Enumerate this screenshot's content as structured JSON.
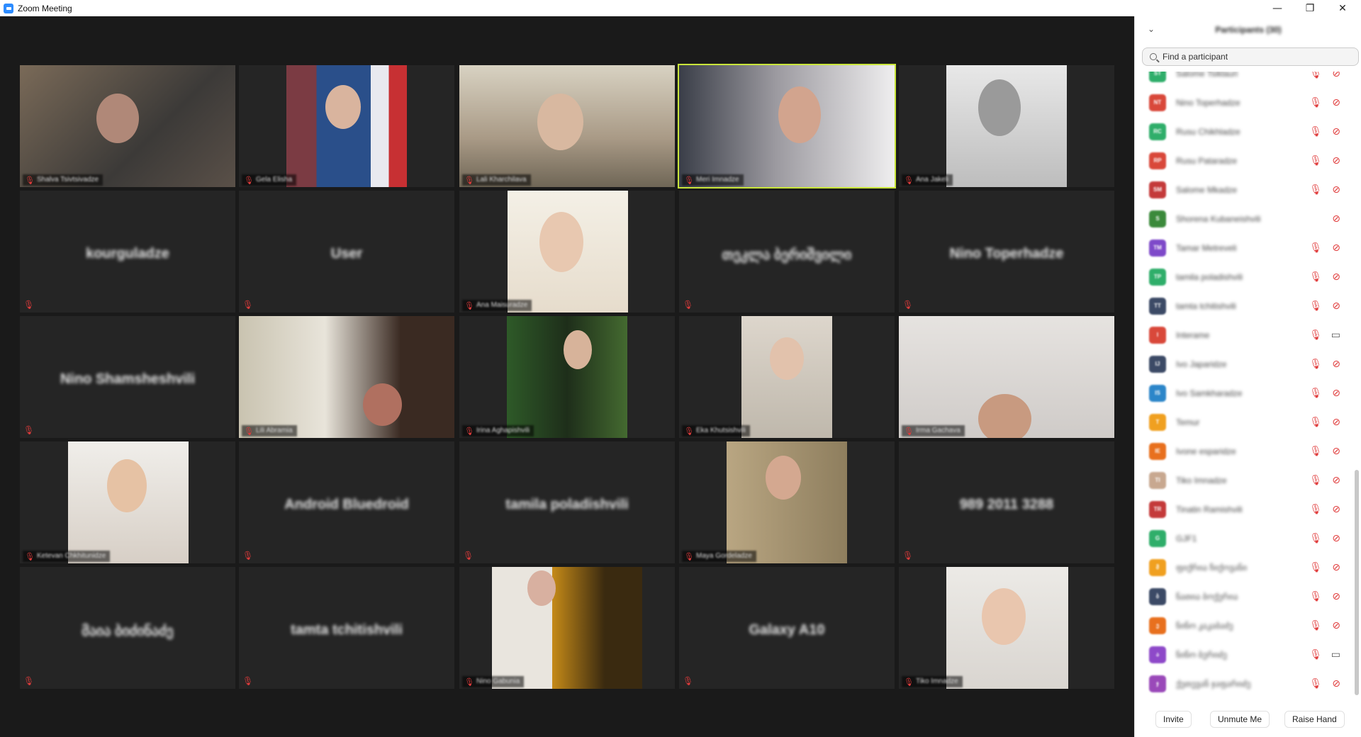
{
  "window": {
    "title": "Zoom Meeting",
    "minimize": "—",
    "maximize": "❐",
    "close": "✕"
  },
  "colors": {
    "active_speaker_border": "#c9e53a",
    "muted_icon": "#e03b3b",
    "tile_bg": "#252525"
  },
  "gallery": {
    "tiles": [
      {
        "kind": "video",
        "label": "Shalva Tsivtsivadze"
      },
      {
        "kind": "video",
        "label": "Gela Elisha"
      },
      {
        "kind": "video",
        "label": "Lali Kharchilava"
      },
      {
        "kind": "video",
        "label": "Meri Imnadze",
        "active": true
      },
      {
        "kind": "video",
        "label": "Ana Jakeli"
      },
      {
        "kind": "name",
        "name": "kourguladze"
      },
      {
        "kind": "name",
        "name": "User"
      },
      {
        "kind": "video",
        "label": "Ana Maisuradze"
      },
      {
        "kind": "name",
        "name": "თეკლა ბერიშვილი"
      },
      {
        "kind": "name",
        "name": "Nino Toperhadze"
      },
      {
        "kind": "name",
        "name": "Nino Shamsheshvili"
      },
      {
        "kind": "video",
        "label": "Lili Abramia"
      },
      {
        "kind": "video",
        "label": "Irina Aghapishvili"
      },
      {
        "kind": "video",
        "label": "Eka Khutsishvili"
      },
      {
        "kind": "video",
        "label": "Irma Gachava"
      },
      {
        "kind": "video",
        "label": "Ketevan Chkhitunidze"
      },
      {
        "kind": "name",
        "name": "Android Bluedroid"
      },
      {
        "kind": "name",
        "name": "tamila poladishvili"
      },
      {
        "kind": "video",
        "label": "Maya Gordeladze"
      },
      {
        "kind": "name",
        "name": "989 2011 3288"
      },
      {
        "kind": "name",
        "name": "მაია ბიძინაძე"
      },
      {
        "kind": "name",
        "name": "tamta tchitishvili"
      },
      {
        "kind": "video",
        "label": "Nino Gabunia"
      },
      {
        "kind": "name",
        "name": "Galaxy A10"
      },
      {
        "kind": "video",
        "label": "Tiko Imnadze"
      }
    ]
  },
  "panel": {
    "title": "Participants (30)",
    "collapse_icon": "⌄",
    "search_placeholder": "Find a participant",
    "participants": [
      {
        "initials": "ST",
        "name": "Salome Tsiklauri",
        "color": "#2fae6a",
        "mic": "muted",
        "cam": "off"
      },
      {
        "initials": "NT",
        "name": "Nino Toperhadze",
        "color": "#d9483a",
        "mic": "muted",
        "cam": "off"
      },
      {
        "initials": "RC",
        "name": "Rusu Chikhladze",
        "color": "#2fae6a",
        "mic": "muted",
        "cam": "off"
      },
      {
        "initials": "RP",
        "name": "Rusu Pataradze",
        "color": "#d9483a",
        "mic": "muted",
        "cam": "off"
      },
      {
        "initials": "SM",
        "name": "Salome Mkadze",
        "color": "#c43a3a",
        "mic": "muted",
        "cam": "off"
      },
      {
        "initials": "S",
        "name": "Shorena Kubaneishvili",
        "color": "#3b8a3b",
        "mic": "none",
        "cam": "off"
      },
      {
        "initials": "TM",
        "name": "Tamar Metreveli",
        "color": "#7e49c9",
        "mic": "muted",
        "cam": "off"
      },
      {
        "initials": "TP",
        "name": "tamila poladishvili",
        "color": "#2fae6a",
        "mic": "muted",
        "cam": "off"
      },
      {
        "initials": "TT",
        "name": "tamta tchitishvili",
        "color": "#3c4a66",
        "mic": "muted",
        "cam": "off"
      },
      {
        "initials": "I",
        "name": "Interame",
        "color": "#d9483a",
        "mic": "muted",
        "cam": "on"
      },
      {
        "initials": "IJ",
        "name": "Ivo Japaridze",
        "color": "#3c4a66",
        "mic": "muted",
        "cam": "off"
      },
      {
        "initials": "IS",
        "name": "Ivo Samkharadze",
        "color": "#2c86c9",
        "mic": "muted",
        "cam": "off"
      },
      {
        "initials": "T",
        "name": "Temur",
        "color": "#f0a020",
        "mic": "muted",
        "cam": "off"
      },
      {
        "initials": "IE",
        "name": "Ivone esparidze",
        "color": "#e8701e",
        "mic": "muted",
        "cam": "off"
      },
      {
        "initials": "TI",
        "name": "Tiko Imnadze",
        "color": "#c8a890",
        "mic": "muted",
        "cam": "off"
      },
      {
        "initials": "TR",
        "name": "Tinatin Ramishvili",
        "color": "#c43a3a",
        "mic": "muted",
        "cam": "off"
      },
      {
        "initials": "G",
        "name": "GJF1",
        "color": "#2fae6a",
        "mic": "muted",
        "cam": "off"
      },
      {
        "initials": "მ",
        "name": "ფიქრია ჩიქოვანი",
        "color": "#f0a020",
        "mic": "muted",
        "cam": "off"
      },
      {
        "initials": "ბ",
        "name": "ნათია ბოქერია",
        "color": "#3c4a66",
        "mic": "muted",
        "cam": "off"
      },
      {
        "initials": "ე",
        "name": "ნინო კაკაბაძე",
        "color": "#e8701e",
        "mic": "muted",
        "cam": "off"
      },
      {
        "initials": "ა",
        "name": "ნინო ბერიძე",
        "color": "#8e49c9",
        "mic": "muted",
        "cam": "on"
      },
      {
        "initials": "ჯ",
        "name": "ქეთევან ჯაფარიძე",
        "color": "#9a49b9",
        "mic": "muted",
        "cam": "off"
      }
    ],
    "buttons": {
      "invite": "Invite",
      "unmute": "Unmute Me",
      "raise_hand": "Raise Hand"
    }
  }
}
